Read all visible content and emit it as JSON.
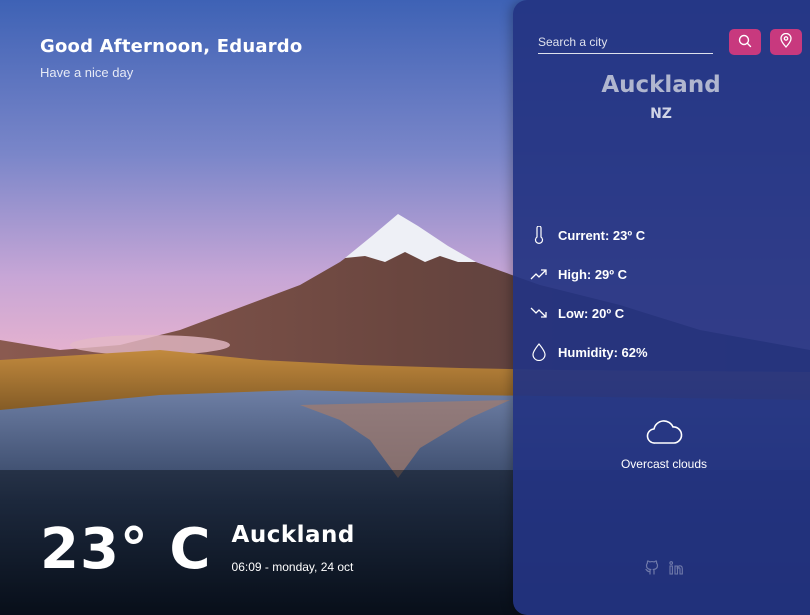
{
  "greeting": {
    "title": "Good Afternoon, Eduardo",
    "subtitle": "Have a nice day"
  },
  "current": {
    "temperature": "23° C",
    "city": "Auckland",
    "datetime": "06:09 - monday, 24 oct"
  },
  "panel": {
    "search": {
      "placeholder": "Search a city",
      "value": ""
    },
    "search_icon": "search-icon",
    "location_icon": "map-pin-icon",
    "city": "Auckland",
    "country": "NZ",
    "stats": [
      {
        "icon": "thermometer-icon",
        "label": "Current: 23º C"
      },
      {
        "icon": "trend-up-icon",
        "label": "High: 29º C"
      },
      {
        "icon": "trend-down-icon",
        "label": "Low: 20º C"
      },
      {
        "icon": "droplet-icon",
        "label": "Humidity: 62%"
      }
    ],
    "condition": {
      "icon": "cloud-icon",
      "label": "Overcast clouds"
    },
    "social": [
      "github-icon",
      "linkedin-icon"
    ]
  },
  "colors": {
    "panel_bg": "#243482",
    "button_accent": "#c8397e",
    "sky_top": "#3e62b5",
    "sky_horizon": "#e6b2cf"
  }
}
